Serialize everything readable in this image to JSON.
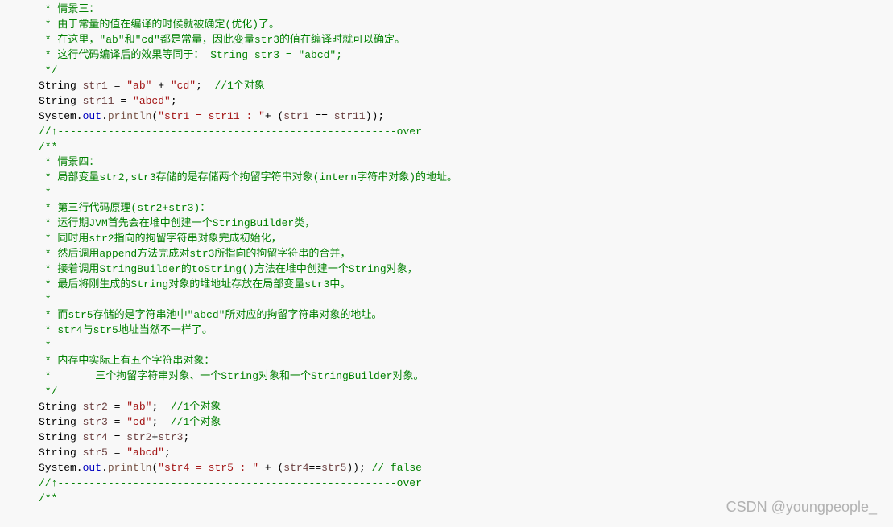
{
  "lines": [
    {
      "type": "comment",
      "text": " * 情景三："
    },
    {
      "type": "comment",
      "text": " * 由于常量的值在编译的时候就被确定(优化)了。"
    },
    {
      "type": "comment",
      "text": " * 在这里，\"ab\"和\"cd\"都是常量，因此变量str3的值在编译时就可以确定。"
    },
    {
      "type": "comment",
      "text": " * 这行代码编译后的效果等同于： String str3 = \"abcd\";"
    },
    {
      "type": "comment",
      "text": " */"
    },
    {
      "type": "code",
      "segments": [
        {
          "cls": "text",
          "t": "String "
        },
        {
          "cls": "var",
          "t": "str1"
        },
        {
          "cls": "text",
          "t": " = "
        },
        {
          "cls": "string",
          "t": "\"ab\""
        },
        {
          "cls": "text",
          "t": " + "
        },
        {
          "cls": "string",
          "t": "\"cd\""
        },
        {
          "cls": "text",
          "t": ";  "
        },
        {
          "cls": "comment",
          "t": "//1个对象"
        }
      ]
    },
    {
      "type": "code",
      "segments": [
        {
          "cls": "text",
          "t": "String "
        },
        {
          "cls": "var",
          "t": "str11"
        },
        {
          "cls": "text",
          "t": " = "
        },
        {
          "cls": "string",
          "t": "\"abcd\""
        },
        {
          "cls": "text",
          "t": ";"
        }
      ]
    },
    {
      "type": "code",
      "segments": [
        {
          "cls": "text",
          "t": "System."
        },
        {
          "cls": "field",
          "t": "out"
        },
        {
          "cls": "text",
          "t": "."
        },
        {
          "cls": "method",
          "t": "println"
        },
        {
          "cls": "text",
          "t": "("
        },
        {
          "cls": "string",
          "t": "\"str1 = str11 : \""
        },
        {
          "cls": "text",
          "t": "+ ("
        },
        {
          "cls": "var",
          "t": "str1"
        },
        {
          "cls": "text",
          "t": " == "
        },
        {
          "cls": "var",
          "t": "str11"
        },
        {
          "cls": "text",
          "t": "));"
        }
      ]
    },
    {
      "type": "comment",
      "text": "//↑------------------------------------------------------over"
    },
    {
      "type": "comment",
      "text": "/**"
    },
    {
      "type": "comment",
      "text": " * 情景四："
    },
    {
      "type": "comment",
      "text": " * 局部变量str2,str3存储的是存储两个拘留字符串对象(intern字符串对象)的地址。"
    },
    {
      "type": "comment",
      "text": " *"
    },
    {
      "type": "comment",
      "text": " * 第三行代码原理(str2+str3)："
    },
    {
      "type": "comment",
      "text": " * 运行期JVM首先会在堆中创建一个StringBuilder类，"
    },
    {
      "type": "comment",
      "text": " * 同时用str2指向的拘留字符串对象完成初始化，"
    },
    {
      "type": "comment",
      "text": " * 然后调用append方法完成对str3所指向的拘留字符串的合并，"
    },
    {
      "type": "comment",
      "text": " * 接着调用StringBuilder的toString()方法在堆中创建一个String对象，"
    },
    {
      "type": "comment",
      "text": " * 最后将刚生成的String对象的堆地址存放在局部变量str3中。"
    },
    {
      "type": "comment",
      "text": " *"
    },
    {
      "type": "comment",
      "text": " * 而str5存储的是字符串池中\"abcd\"所对应的拘留字符串对象的地址。"
    },
    {
      "type": "comment",
      "text": " * str4与str5地址当然不一样了。"
    },
    {
      "type": "comment",
      "text": " *"
    },
    {
      "type": "comment",
      "text": " * 内存中实际上有五个字符串对象："
    },
    {
      "type": "comment",
      "text": " *       三个拘留字符串对象、一个String对象和一个StringBuilder对象。"
    },
    {
      "type": "comment",
      "text": " */"
    },
    {
      "type": "code",
      "segments": [
        {
          "cls": "text",
          "t": "String "
        },
        {
          "cls": "var",
          "t": "str2"
        },
        {
          "cls": "text",
          "t": " = "
        },
        {
          "cls": "string",
          "t": "\"ab\""
        },
        {
          "cls": "text",
          "t": ";  "
        },
        {
          "cls": "comment",
          "t": "//1个对象"
        }
      ]
    },
    {
      "type": "code",
      "segments": [
        {
          "cls": "text",
          "t": "String "
        },
        {
          "cls": "var",
          "t": "str3"
        },
        {
          "cls": "text",
          "t": " = "
        },
        {
          "cls": "string",
          "t": "\"cd\""
        },
        {
          "cls": "text",
          "t": ";  "
        },
        {
          "cls": "comment",
          "t": "//1个对象"
        }
      ]
    },
    {
      "type": "code",
      "segments": [
        {
          "cls": "text",
          "t": "String "
        },
        {
          "cls": "var",
          "t": "str4"
        },
        {
          "cls": "text",
          "t": " = "
        },
        {
          "cls": "var",
          "t": "str2"
        },
        {
          "cls": "text",
          "t": "+"
        },
        {
          "cls": "var",
          "t": "str3"
        },
        {
          "cls": "text",
          "t": ";"
        }
      ]
    },
    {
      "type": "code",
      "segments": [
        {
          "cls": "text",
          "t": "String "
        },
        {
          "cls": "var",
          "t": "str5"
        },
        {
          "cls": "text",
          "t": " = "
        },
        {
          "cls": "string",
          "t": "\"abcd\""
        },
        {
          "cls": "text",
          "t": ";"
        }
      ]
    },
    {
      "type": "code",
      "segments": [
        {
          "cls": "text",
          "t": "System."
        },
        {
          "cls": "field",
          "t": "out"
        },
        {
          "cls": "text",
          "t": "."
        },
        {
          "cls": "method",
          "t": "println"
        },
        {
          "cls": "text",
          "t": "("
        },
        {
          "cls": "string",
          "t": "\"str4 = str5 : \""
        },
        {
          "cls": "text",
          "t": " + ("
        },
        {
          "cls": "var",
          "t": "str4"
        },
        {
          "cls": "text",
          "t": "=="
        },
        {
          "cls": "var",
          "t": "str5"
        },
        {
          "cls": "text",
          "t": ")); "
        },
        {
          "cls": "comment",
          "t": "// false"
        }
      ]
    },
    {
      "type": "comment",
      "text": "//↑------------------------------------------------------over"
    },
    {
      "type": "comment",
      "text": "/**"
    }
  ],
  "watermark": "CSDN @youngpeople_"
}
